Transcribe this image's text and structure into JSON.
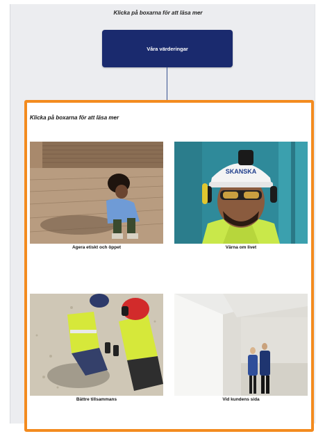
{
  "header": {
    "instruction": "Klicka på boxarna för att läsa mer",
    "values_button_label": "Våra värderingar"
  },
  "section": {
    "instruction": "Klicka på boxarna för att läsa mer",
    "cards": [
      {
        "caption": "Agera etiskt och öppet"
      },
      {
        "caption": "Värna om livet",
        "helmet_text": "SKANSKA"
      },
      {
        "caption": "Bättre tillsammans"
      },
      {
        "caption": "Vid kundens sida"
      }
    ]
  },
  "colors": {
    "navy_button": "#1a2a6e",
    "accent_orange": "#f38b1f",
    "connector": "#35508f",
    "panel_bg": "#ecedf0"
  }
}
